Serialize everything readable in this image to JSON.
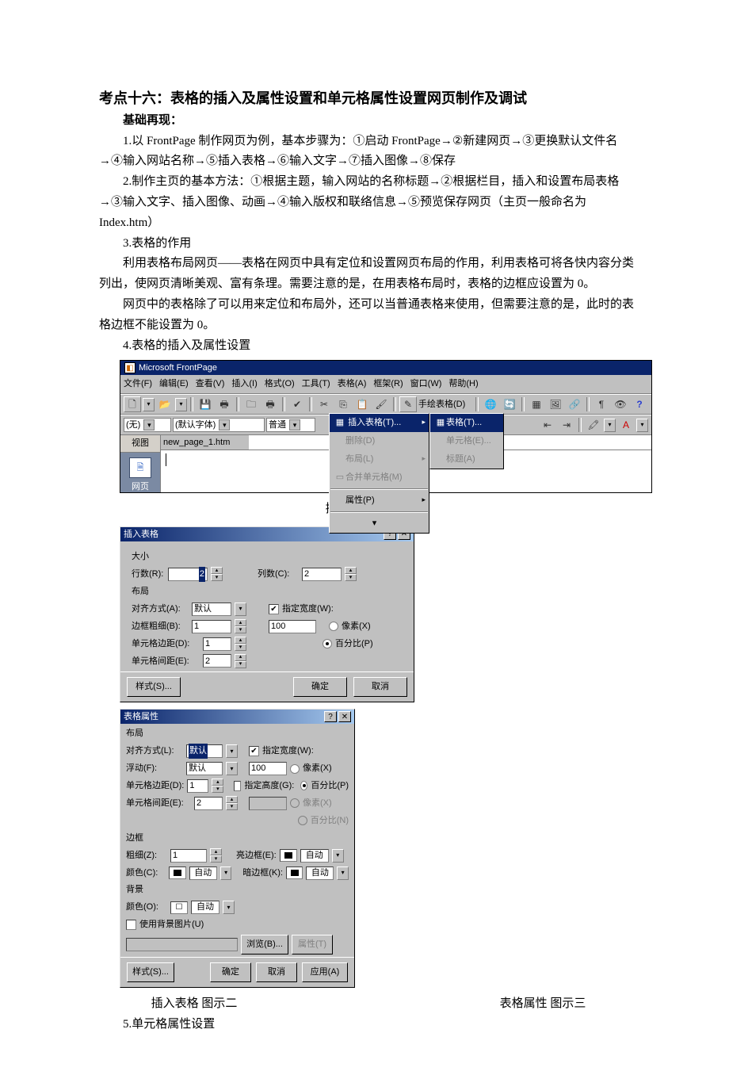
{
  "title": "考点十六：表格的插入及属性设置和单元格属性设置网页制作及调试",
  "subhead": "基础再现：",
  "p1": "1.以 FrontPage 制作网页为例，基本步骤为：①启动 FrontPage→②新建网页→③更换默认文件名→④输入网站名称→⑤插入表格→⑥输入文字→⑦插入图像→⑧保存",
  "p2": "2.制作主页的基本方法：①根据主题，输入网站的名称标题→②根据栏目，插入和设置布局表格→③输入文字、插入图像、动画→④输入版权和联络信息→⑤预览保存网页（主页一般命名为 Index.htm）",
  "p3": "3.表格的作用",
  "p4": "利用表格布局网页——表格在网页中具有定位和设置网页布局的作用，利用表格可将各快内容分类列出，使网页清晰美观、富有条理。需要注意的是，在用表格布局时，表格的边框应设置为 0。",
  "p5": "网页中的表格除了可以用来定位和布局外，还可以当普通表格来使用，但需要注意的是，此时的表格边框不能设置为 0。",
  "p6": "4.表格的插入及属性设置",
  "caption1": "插入表格 图示一",
  "caption2": "插入表格 图示二",
  "caption3": "表格属性 图示三",
  "p7": "5.单元格属性设置",
  "fp": {
    "title": "Microsoft FrontPage",
    "menubar": [
      "文件(F)",
      "编辑(E)",
      "查看(V)",
      "插入(I)",
      "格式(O)",
      "工具(T)",
      "表格(A)",
      "框架(R)",
      "窗口(W)",
      "帮助(H)"
    ],
    "combo_none": "(无)",
    "combo_font": "(默认字体)",
    "combo_size": "普通",
    "style_btn": "手绘表格(D)",
    "sidebar_label": "视图",
    "sidebar_item": "网页",
    "tab1": "new_page_1.htm",
    "menu1": [
      {
        "text": "插入表格(T)...",
        "sel": true
      },
      {
        "text": "删除(D)",
        "dis": true
      },
      {
        "text": "布局(L)",
        "dis": true,
        "arr": true
      },
      {
        "text": "合并单元格(M)",
        "dis": true
      },
      {
        "text": "属性(P)",
        "arr": true
      }
    ],
    "menu1_extra": "▾",
    "menu2": [
      {
        "text": "表格(T)...",
        "sel": true
      },
      {
        "text": "单元格(E)...",
        "dis": true
      },
      {
        "text": "标题(A)",
        "dis": true
      }
    ]
  },
  "dlg2": {
    "title": "插入表格",
    "grp_size": "大小",
    "rows_label": "行数(R):",
    "rows_val": "2",
    "cols_label": "列数(C):",
    "cols_val": "2",
    "grp_layout": "布局",
    "align_label": "对齐方式(A):",
    "align_val": "默认",
    "border_label": "边框粗细(B):",
    "border_val": "1",
    "pad_label": "单元格边距(D):",
    "pad_val": "1",
    "space_label": "单元格间距(E):",
    "space_val": "2",
    "specw_label": "指定宽度(W):",
    "width_val": "100",
    "px_label": "像素(X)",
    "pct_label": "百分比(P)",
    "style_btn": "样式(S)...",
    "ok": "确定",
    "cancel": "取消"
  },
  "dlg3": {
    "title": "表格属性",
    "grp_layout": "布局",
    "align_label": "对齐方式(L):",
    "align_val": "默认",
    "float_label": "浮动(F):",
    "float_val": "默认",
    "pad_label": "单元格边距(D):",
    "pad_val": "1",
    "space_label": "单元格间距(E):",
    "space_val": "2",
    "specw_label": "指定宽度(W):",
    "width_val": "100",
    "px_label": "像素(X)",
    "pct_label": "百分比(P)",
    "spech_label": "指定高度(G):",
    "px_label2": "像素(X)",
    "pct_label2": "百分比(N)",
    "grp_border": "边框",
    "bsize_label": "粗细(Z):",
    "bsize_val": "1",
    "bcolor_label": "颜色(C):",
    "auto": "自动",
    "light_label": "亮边框(E):",
    "dark_label": "暗边框(K):",
    "grp_bg": "背景",
    "bgcolor_label": "颜色(O):",
    "bgimg_label": "使用背景图片(U)",
    "browse": "浏览(B)...",
    "props": "属性(T)",
    "style_btn": "样式(S)...",
    "ok": "确定",
    "cancel": "取消",
    "apply": "应用(A)"
  }
}
